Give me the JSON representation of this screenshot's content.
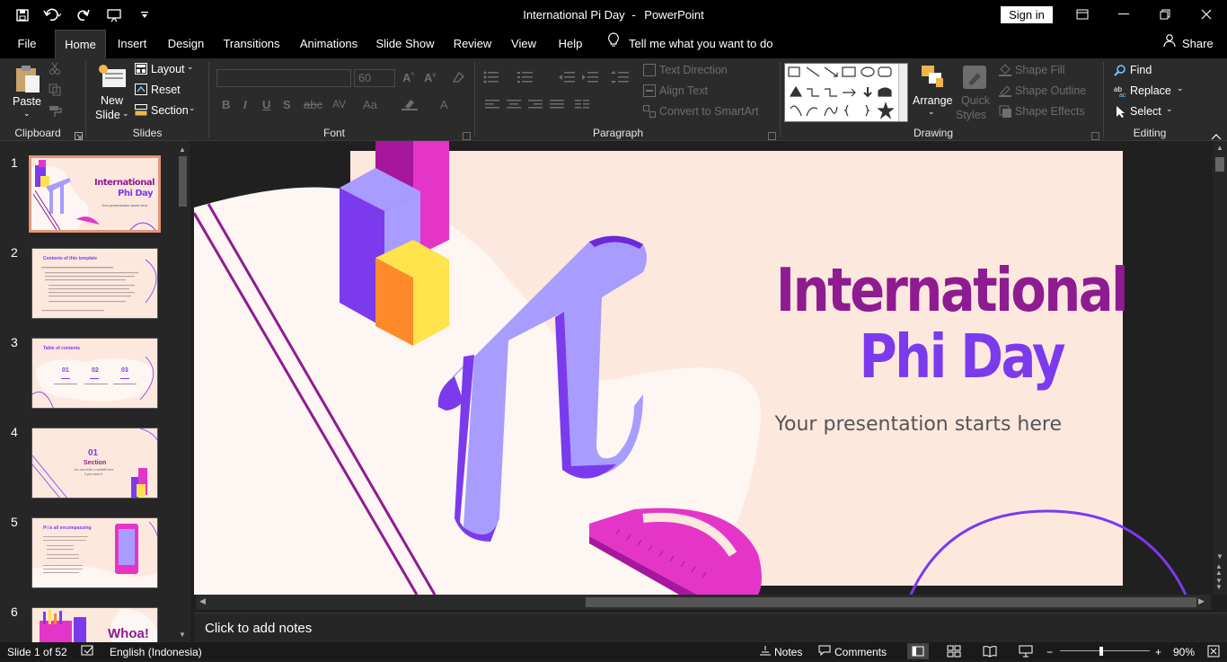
{
  "app": {
    "document_title": "International Pi Day",
    "app_name": "PowerPoint",
    "title_separator": "-",
    "sign_in": "Sign in"
  },
  "tabs": [
    "File",
    "Home",
    "Insert",
    "Design",
    "Transitions",
    "Animations",
    "Slide Show",
    "Review",
    "View",
    "Help"
  ],
  "active_tab": "Home",
  "tell_me": "Tell me what you want to do",
  "share": "Share",
  "ribbon": {
    "clipboard": {
      "label": "Clipboard",
      "paste": "Paste"
    },
    "slides": {
      "label": "Slides",
      "new_slide_line1": "New",
      "new_slide_line2": "Slide",
      "layout": "Layout",
      "reset": "Reset",
      "section": "Section"
    },
    "font": {
      "label": "Font",
      "size": "60"
    },
    "paragraph": {
      "label": "Paragraph",
      "text_direction": "Text Direction",
      "align_text": "Align Text",
      "convert_smartart": "Convert to SmartArt"
    },
    "drawing": {
      "label": "Drawing",
      "arrange": "Arrange",
      "quick_styles_line1": "Quick",
      "quick_styles_line2": "Styles",
      "shape_fill": "Shape Fill",
      "shape_outline": "Shape Outline",
      "shape_effects": "Shape Effects"
    },
    "editing": {
      "label": "Editing",
      "find": "Find",
      "replace": "Replace",
      "select": "Select"
    }
  },
  "thumbnails": [
    {
      "num": "1",
      "title_line1": "International",
      "title_line2": "Phi Day",
      "subtitle": "Your presentation starts here"
    },
    {
      "num": "2",
      "title": "Contents of this template"
    },
    {
      "num": "3",
      "title": "Table of contents",
      "items": [
        "01",
        "02",
        "03"
      ]
    },
    {
      "num": "4",
      "number": "01",
      "section": "Section",
      "desc_line1": "You can enter a subtitle here",
      "desc_line2": "if you need it"
    },
    {
      "num": "5",
      "title": "Pi is all encompassing"
    },
    {
      "num": "6",
      "title": "Whoa!"
    }
  ],
  "slide": {
    "title_line1": "International",
    "title_line2": "Phi Day",
    "subtitle": "Your presentation starts here"
  },
  "notes_placeholder": "Click to add notes",
  "status": {
    "slide_label": "Slide 1 of 52",
    "language": "English (Indonesia)",
    "notes": "Notes",
    "comments": "Comments",
    "zoom": "90%"
  },
  "colors": {
    "title_magenta": "#8f1b91",
    "title_violet": "#7c3aed",
    "slide_bg": "#fde8de",
    "thumb_border_selected": "#e3967a"
  }
}
